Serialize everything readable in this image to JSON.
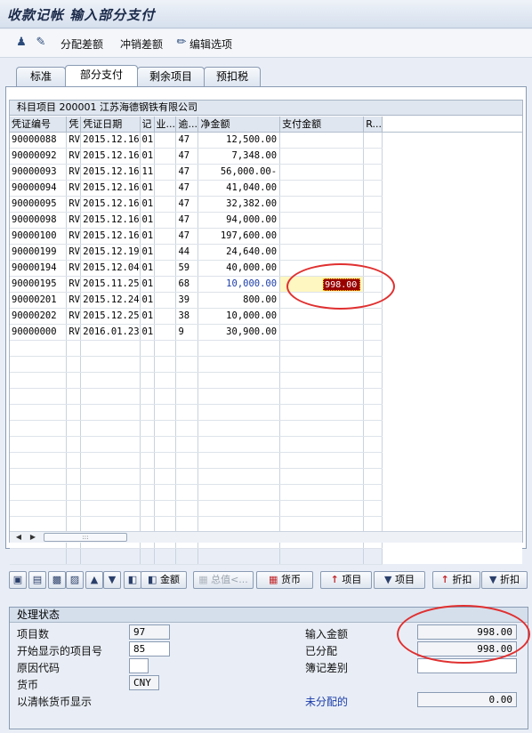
{
  "title": "收款记帐 输入部分支付",
  "toolbar": {
    "distribute_diff": "分配差额",
    "reverse_diff": "冲销差额",
    "edit_options": "编辑选项"
  },
  "tabs": [
    "标准",
    "部分支付",
    "剩余项目",
    "预扣税"
  ],
  "active_tab": "部分支付",
  "grid": {
    "caption": "科目项目 200001 江苏海德钢铁有限公司",
    "columns": [
      "凭证编号",
      "凭",
      "凭证日期",
      "记",
      "业...",
      "逾...",
      "净金额",
      "支付金额",
      "R..."
    ],
    "rows": [
      [
        "90000088",
        "RV",
        "2015.12.16",
        "01",
        "",
        "47",
        "12,500.00",
        ""
      ],
      [
        "90000092",
        "RV",
        "2015.12.16",
        "01",
        "",
        "47",
        "7,348.00",
        ""
      ],
      [
        "90000093",
        "RV",
        "2015.12.16",
        "11",
        "",
        "47",
        "56,000.00-",
        ""
      ],
      [
        "90000094",
        "RV",
        "2015.12.16",
        "01",
        "",
        "47",
        "41,040.00",
        ""
      ],
      [
        "90000095",
        "RV",
        "2015.12.16",
        "01",
        "",
        "47",
        "32,382.00",
        ""
      ],
      [
        "90000098",
        "RV",
        "2015.12.16",
        "01",
        "",
        "47",
        "94,000.00",
        ""
      ],
      [
        "90000100",
        "RV",
        "2015.12.16",
        "01",
        "",
        "47",
        "197,600.00",
        ""
      ],
      [
        "90000199",
        "RV",
        "2015.12.19",
        "01",
        "",
        "44",
        "24,640.00",
        ""
      ],
      [
        "90000194",
        "RV",
        "2015.12.04",
        "01",
        "",
        "59",
        "40,000.00",
        ""
      ],
      [
        "90000195",
        "RV",
        "2015.11.25",
        "01",
        "",
        "68",
        "10,000.00",
        "998.00"
      ],
      [
        "90000201",
        "RV",
        "2015.12.24",
        "01",
        "",
        "39",
        "800.00",
        ""
      ],
      [
        "90000202",
        "RV",
        "2015.12.25",
        "01",
        "",
        "38",
        "10,000.00",
        ""
      ],
      [
        "90000000",
        "RV",
        "2016.01.23",
        "01",
        "",
        "9",
        "30,900.00",
        ""
      ]
    ],
    "empty_rows": 14,
    "selected_row_index": 9
  },
  "buttons": {
    "amount": "金额",
    "total": "总值<...",
    "currency": "货币",
    "item1": "项目",
    "item2": "项目",
    "discount1": "折扣",
    "discount2": "折扣"
  },
  "status": {
    "header": "处理状态",
    "item_count_label": "项目数",
    "item_count": "97",
    "start_item_label": "开始显示的项目号",
    "start_item": "85",
    "reason_code_label": "原因代码",
    "reason_code": "",
    "currency_label": "货币",
    "currency": "CNY",
    "clearing_currency_label": "以清帐货币显示",
    "entered_amount_label": "输入金额",
    "entered_amount": "998.00",
    "assigned_label": "已分配",
    "assigned": "998.00",
    "posting_diff_label": "簿记差别",
    "posting_diff": "",
    "unassigned_label": "未分配的",
    "unassigned": "0.00"
  },
  "colors": {
    "annotation_circle": "#e03030",
    "selected_amount_bg": "#990000",
    "link_blue": "#1b3ca8"
  }
}
